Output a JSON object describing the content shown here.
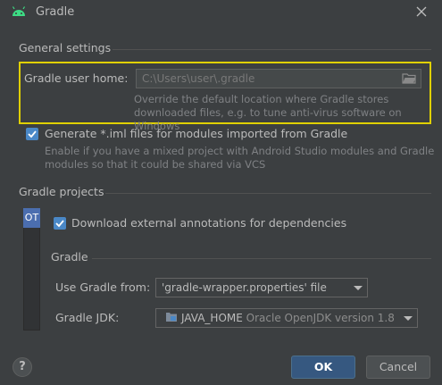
{
  "window": {
    "title": "Gradle",
    "logo_icon": "android-icon",
    "close_icon": "close-icon"
  },
  "general": {
    "section_title": "General settings",
    "gradle_user_home": {
      "label": "Gradle user home:",
      "value": "C:\\Users\\user\\.gradle",
      "hint_line1": "Override the default location where Gradle stores",
      "hint_line2": "downloaded files, e.g. to tune anti-virus software on Windows"
    },
    "generate_iml": {
      "checked": true,
      "label": "Generate *.iml files for modules imported from Gradle",
      "hint_line1": "Enable if you have a mixed project with Android Studio modules and Gradle",
      "hint_line2": "modules so that it could be shared via VCS"
    }
  },
  "projects": {
    "section_title": "Gradle projects",
    "tab_label": "OT",
    "download_annotations": {
      "checked": true,
      "label": "Download external annotations for dependencies"
    },
    "gradle_subsection": "Gradle",
    "use_gradle_from": {
      "label": "Use Gradle from:",
      "value": "'gradle-wrapper.properties' file"
    },
    "gradle_jdk": {
      "label": "Gradle JDK:",
      "value_name": "JAVA_HOME",
      "value_detail": "Oracle OpenJDK version 1.8"
    }
  },
  "footer": {
    "help_label": "?",
    "ok_label": "OK",
    "cancel_label": "Cancel"
  },
  "colors": {
    "accent": "#4a88c7",
    "highlight": "#e0d000",
    "ok_button": "#365880"
  }
}
